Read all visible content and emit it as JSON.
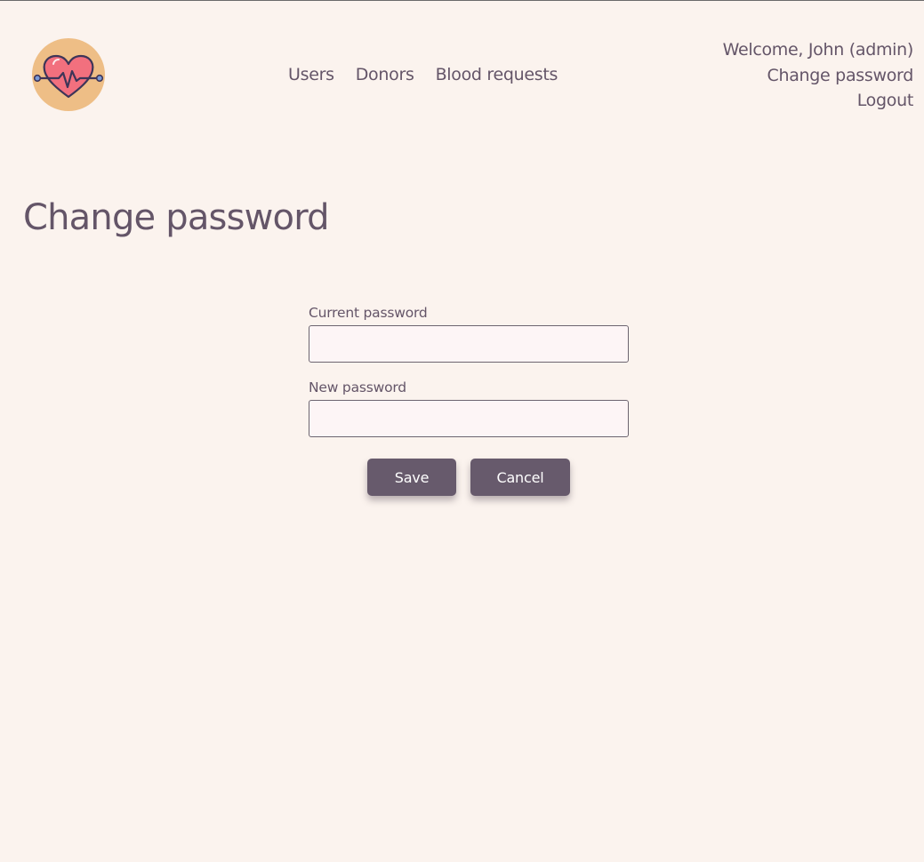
{
  "header": {
    "logo_icon": "heartbeat-icon",
    "nav": {
      "users": "Users",
      "donors": "Donors",
      "blood_requests": "Blood requests"
    },
    "user": {
      "welcome": "Welcome, John (admin)",
      "change_password": "Change password",
      "logout": "Logout"
    }
  },
  "page": {
    "title": "Change password"
  },
  "form": {
    "current_password": {
      "label": "Current password",
      "value": ""
    },
    "new_password": {
      "label": "New password",
      "value": ""
    },
    "save_label": "Save",
    "cancel_label": "Cancel"
  },
  "colors": {
    "background": "#fbf3ee",
    "text": "#645568",
    "button": "#675a6c",
    "logo_circle": "#eebe86",
    "heart": "#f2707e"
  }
}
